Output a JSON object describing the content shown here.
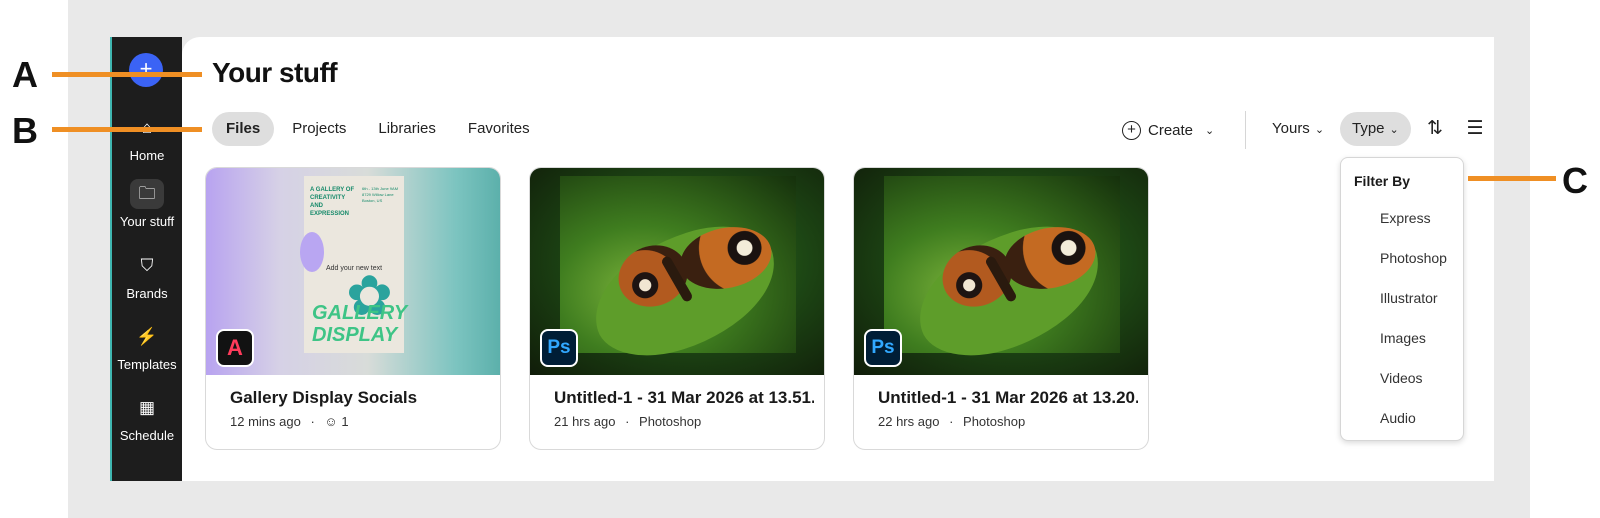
{
  "callouts": {
    "a": "A",
    "b": "B",
    "c": "C"
  },
  "rail": {
    "plus": "+",
    "items": [
      {
        "label": "Home",
        "icon": "home-icon",
        "glyph": "⌂"
      },
      {
        "label": "Your stuff",
        "icon": "folder-icon",
        "glyph": "🗀"
      },
      {
        "label": "Brands",
        "icon": "brand-shield-icon",
        "glyph": "⛉"
      },
      {
        "label": "Templates",
        "icon": "templates-icon",
        "glyph": "⚡"
      },
      {
        "label": "Schedule",
        "icon": "calendar-icon",
        "glyph": "▦"
      }
    ]
  },
  "page": {
    "title": "Your stuff"
  },
  "tabs": [
    "Files",
    "Projects",
    "Libraries",
    "Favorites"
  ],
  "toolbar": {
    "create": "Create",
    "yours": "Yours",
    "type": "Type",
    "sort_icon": "sort-icon",
    "list_icon": "list-view-icon"
  },
  "cards": [
    {
      "name": "Gallery Display Socials",
      "time": "12 mins ago",
      "dot": "·",
      "collab": "1",
      "app_badge": "A"
    },
    {
      "name": "Untitled-1 - 31 Mar 2026 at 13.51.…",
      "time": "21 hrs ago",
      "dot": "·",
      "app": "Photoshop",
      "app_badge": "Ps"
    },
    {
      "name": "Untitled-1 - 31 Mar 2026 at 13.20.…",
      "time": "22 hrs ago",
      "dot": "·",
      "app": "Photoshop",
      "app_badge": "Ps"
    }
  ],
  "poster": {
    "title": "A GALLERY OF CREATIVITY AND EXPRESSION",
    "sub": "6th - 13th June 9AM 8729 Willow Lane Boston, US",
    "add": "Add your new text",
    "big": "GALLERY DISPLAY"
  },
  "filter_menu": {
    "heading": "Filter By",
    "items": [
      "Express",
      "Photoshop",
      "Illustrator",
      "Images",
      "Videos",
      "Audio"
    ]
  },
  "colors": {
    "accent": "#ef8f24",
    "rail": "#1d1d1d",
    "plus": "#3b63f5"
  }
}
